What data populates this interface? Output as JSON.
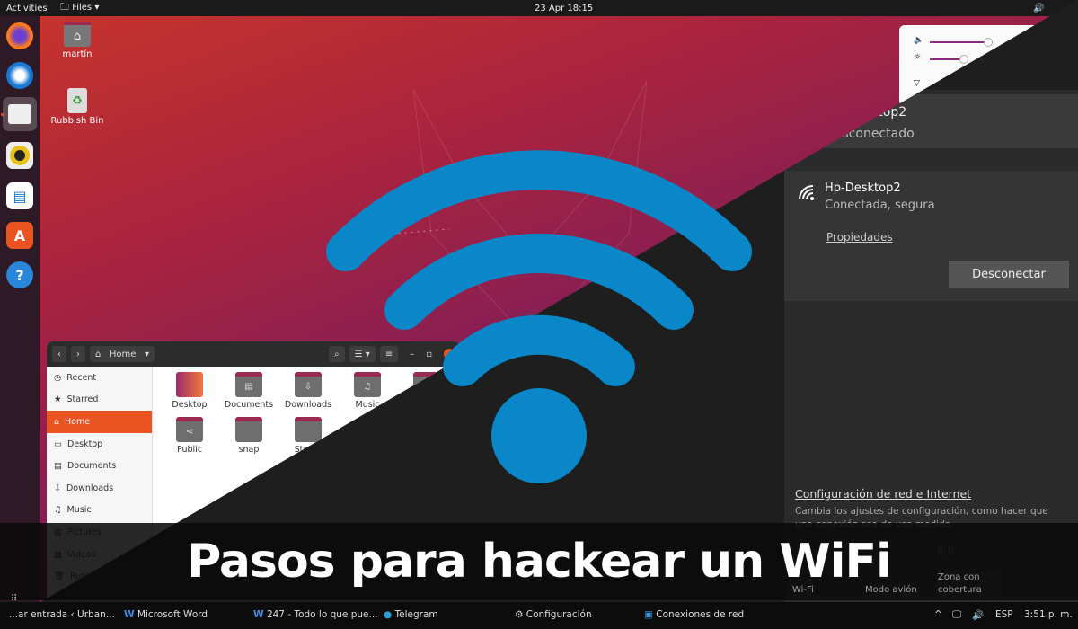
{
  "ubuntu": {
    "topbar": {
      "activities": "Activities",
      "app_menu": "Files",
      "clock": "23 Apr  18:15"
    },
    "dock": [
      {
        "icon": "firefox-icon"
      },
      {
        "icon": "thunderbird-icon"
      },
      {
        "icon": "files-icon",
        "active": true
      },
      {
        "icon": "rhythmbox-icon"
      },
      {
        "icon": "writer-icon"
      },
      {
        "icon": "software-icon"
      },
      {
        "icon": "help-icon"
      }
    ],
    "desktop": [
      {
        "label": "martín",
        "icon": "home-folder-icon"
      },
      {
        "label": "Rubbish Bin",
        "icon": "trash-icon"
      }
    ],
    "quick_settings": {
      "volume": 0.65,
      "brightness": 0.4
    },
    "files": {
      "location": "Home",
      "sidebar": [
        {
          "label": "Recent",
          "icon": "◷"
        },
        {
          "label": "Starred",
          "icon": "★"
        },
        {
          "label": "Home",
          "icon": "⌂",
          "active": true
        },
        {
          "label": "Desktop",
          "icon": "▭"
        },
        {
          "label": "Documents",
          "icon": "▤"
        },
        {
          "label": "Downloads",
          "icon": "⇩"
        },
        {
          "label": "Music",
          "icon": "♫"
        },
        {
          "label": "Pictures",
          "icon": "▨"
        },
        {
          "label": "Videos",
          "icon": "▦"
        },
        {
          "label": "Rubbish Bin",
          "icon": "🗑"
        }
      ],
      "items": [
        {
          "label": "Desktop",
          "glyph": ""
        },
        {
          "label": "Documents",
          "glyph": "▤"
        },
        {
          "label": "Downloads",
          "glyph": "⇩"
        },
        {
          "label": "Music",
          "glyph": "♫"
        },
        {
          "label": "Pictures",
          "glyph": "▨"
        },
        {
          "label": "Public",
          "glyph": "⋖"
        },
        {
          "label": "snap",
          "glyph": ""
        },
        {
          "label": "Steam",
          "glyph": ""
        }
      ]
    }
  },
  "windows": {
    "network_top": {
      "name": "Hp-Desktop2",
      "status": "Desconectado"
    },
    "network": {
      "name": "Hp-Desktop2",
      "status": "Conectada, segura",
      "properties": "Propiedades",
      "disconnect": "Desconectar"
    },
    "settings_link": "Configuración de red e Internet",
    "settings_desc": "Cambia los ajustes de configuración, como hacer que una conexión sea de uso medido.",
    "tiles": [
      "Wi-Fi",
      "Modo avión",
      "Zona con cobertura"
    ],
    "taskbar": {
      "items": [
        "...ar entrada ‹ Urban...",
        "Microsoft Word",
        "247 - Todo lo que pue...",
        "Telegram",
        "Configuración",
        "Conexiones de red"
      ],
      "lang": "ESP",
      "time": "3:51 p. m."
    }
  },
  "headline": "Pasos para hackear un WiFi",
  "colors": {
    "wifi": "#0a87c9",
    "ubuntu_orange": "#e95420"
  }
}
